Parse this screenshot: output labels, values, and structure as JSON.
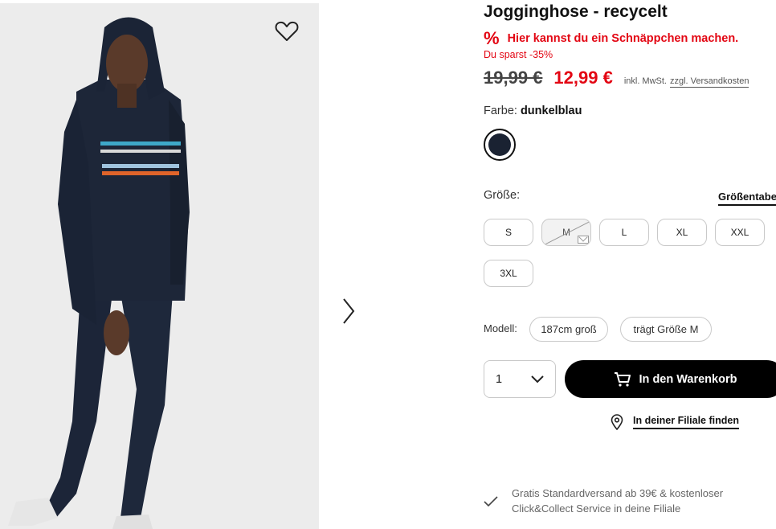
{
  "product": {
    "title": "Jogginghose - recycelt",
    "deal_icon": "%",
    "deal_text": "Hier kannst du ein Schnäppchen machen.",
    "savings_text": "Du sparst -35%",
    "old_price": "19,99 €",
    "new_price": "12,99 €",
    "tax_note": "inkl. MwSt.",
    "shipping_link": "zzgl. Versandkosten"
  },
  "color": {
    "label": "Farbe: ",
    "value": "dunkelblau",
    "swatch_hex": "#1a2232"
  },
  "size": {
    "label": "Größe:",
    "table_link": "Größentabe",
    "options": [
      {
        "label": "S",
        "available": true
      },
      {
        "label": "M",
        "available": false
      },
      {
        "label": "L",
        "available": true
      },
      {
        "label": "XL",
        "available": true
      },
      {
        "label": "XXL",
        "available": true
      },
      {
        "label": "3XL",
        "available": true
      }
    ]
  },
  "model": {
    "label": "Modell:",
    "height": "187cm groß",
    "wears": "trägt Größe M"
  },
  "cart": {
    "quantity": "1",
    "button_label": "In den Warenkorb"
  },
  "store": {
    "link_label": "In deiner Filiale finden"
  },
  "shipping": {
    "text": "Gratis Standardversand ab 39€ & kostenloser Click&Collect Service in deine Filiale"
  },
  "colors": {
    "sale_red": "#e30613",
    "button_black": "#000000"
  },
  "icons": {
    "wishlist": "heart-icon",
    "next": "chevron-right-icon",
    "quantity": "chevron-down-icon",
    "cart": "cart-icon",
    "store": "location-pin-icon",
    "shipping": "check-icon"
  }
}
